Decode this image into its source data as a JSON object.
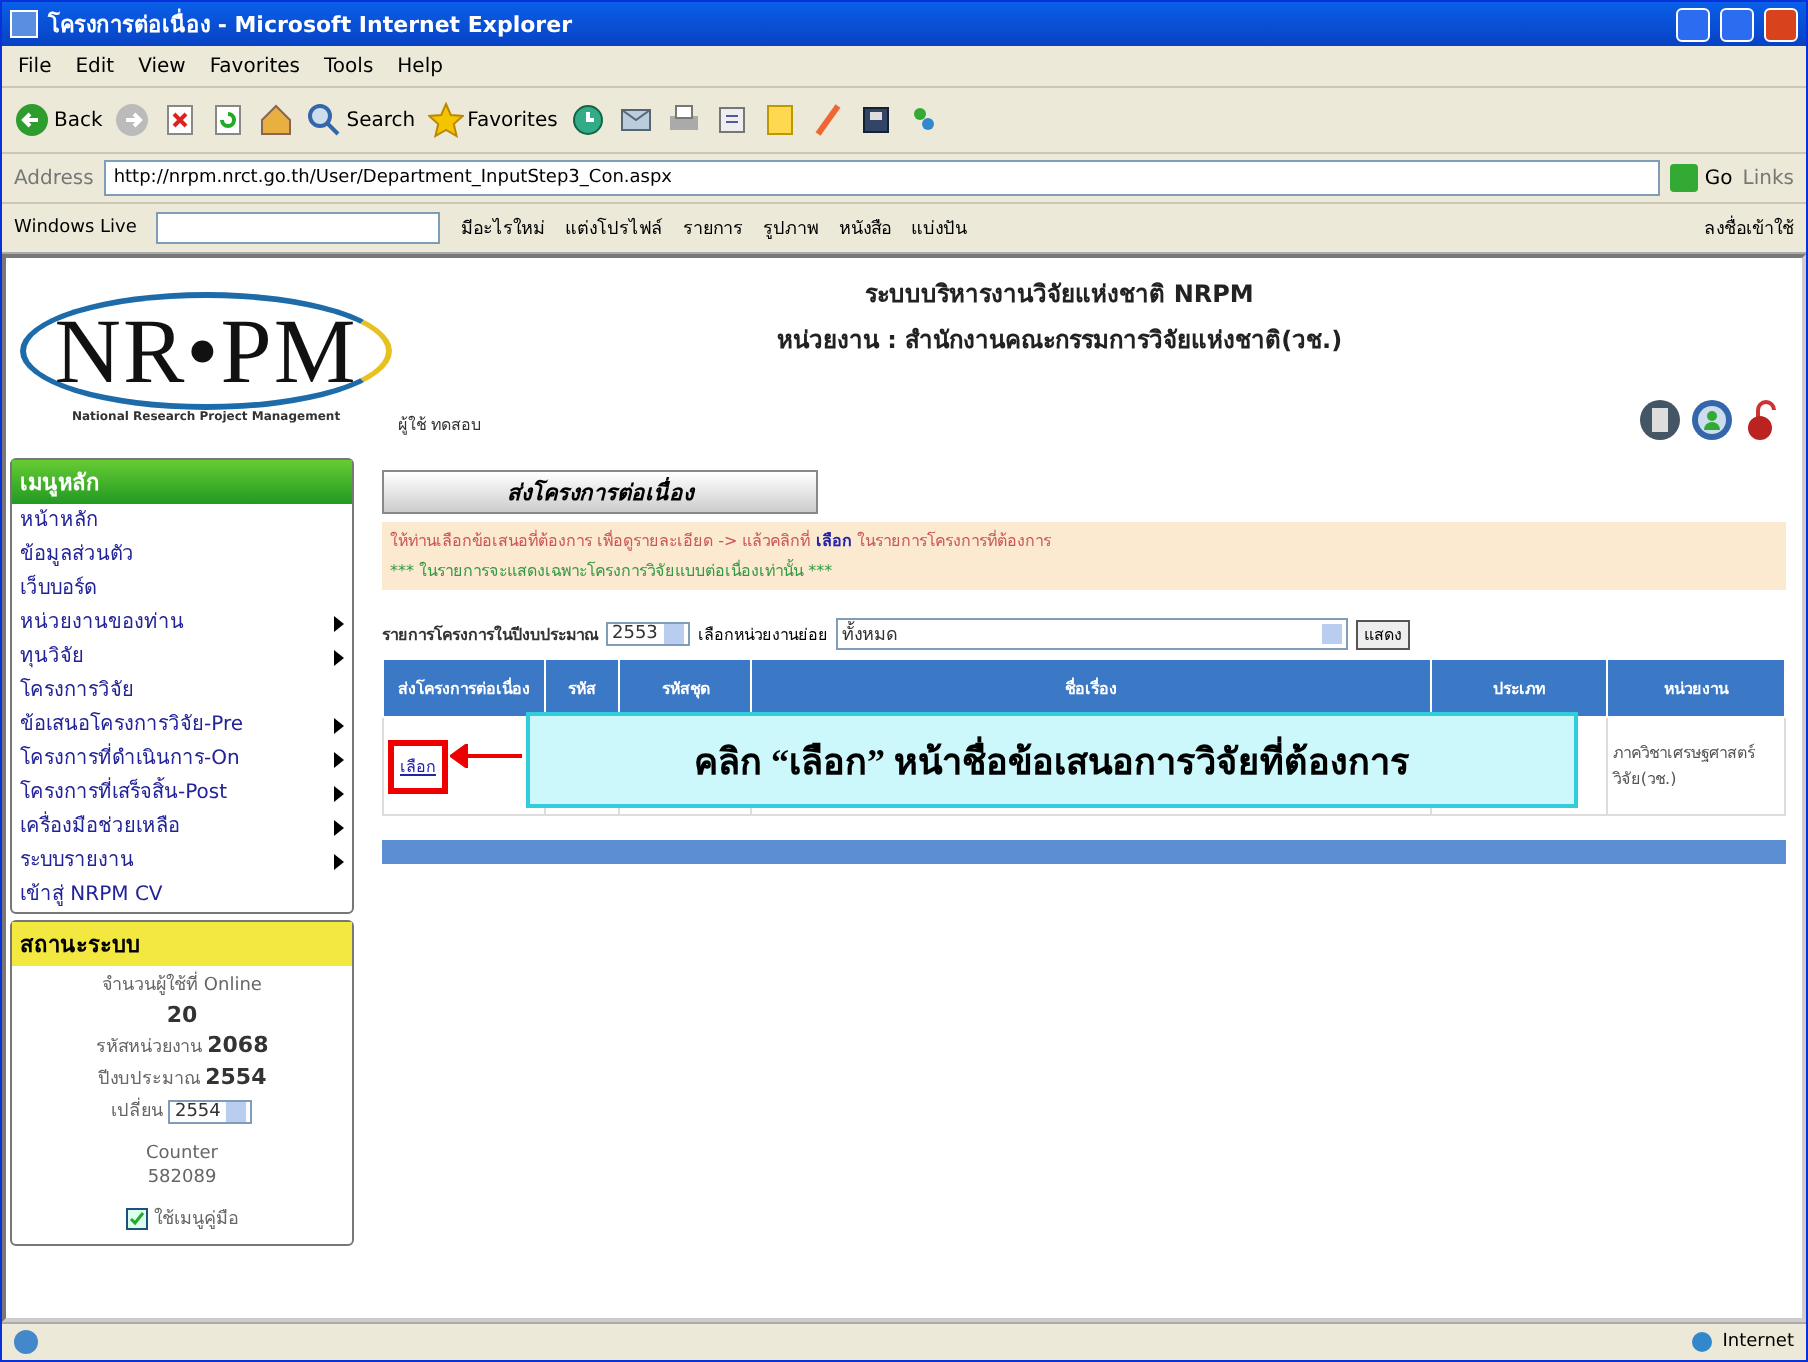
{
  "window": {
    "title": "โครงการต่อเนื่อง - Microsoft Internet Explorer"
  },
  "menu_bar": [
    "File",
    "Edit",
    "View",
    "Favorites",
    "Tools",
    "Help"
  ],
  "toolbar": [
    {
      "kind": "back",
      "label": "Back"
    },
    {
      "kind": "forward"
    },
    {
      "kind": "stop"
    },
    {
      "kind": "refresh"
    },
    {
      "kind": "home"
    },
    {
      "kind": "search",
      "label": "Search"
    },
    {
      "kind": "favorites",
      "label": "Favorites"
    },
    {
      "kind": "history"
    },
    {
      "kind": "mail"
    },
    {
      "kind": "print"
    },
    {
      "kind": "edit"
    },
    {
      "kind": "note"
    },
    {
      "kind": "pen"
    },
    {
      "kind": "book"
    },
    {
      "kind": "messenger"
    }
  ],
  "address_bar": {
    "label": "Address",
    "url": "http://nrpm.nrct.go.th/User/Department_InputStep3_Con.aspx",
    "go": "Go",
    "links": "Links"
  },
  "live_toolbar": {
    "label": "Windows Live",
    "links": [
      "มีอะไรใหม่",
      "แต่งโปรไฟล์",
      "รายการ",
      "รูปภาพ",
      "หนังสือ",
      "แบ่งปัน"
    ],
    "sign_in": "ลงชื่อเข้าใช้"
  },
  "header": {
    "system_title": "ระบบบริหารงานวิจัยแห่งชาติ NRPM",
    "agency": "หน่วยงาน : สำนักงานคณะกรรมการวิจัยแห่งชาติ(วช.)",
    "logo": "NR•PM",
    "logo_subtitle": "National Research Project Management",
    "user": "ผู้ใช้ ทดสอบ"
  },
  "sidebar": {
    "title": "เมนูหลัก",
    "items": [
      {
        "label": "หน้าหลัก",
        "submenu": false
      },
      {
        "label": "ข้อมูลส่วนตัว",
        "submenu": false
      },
      {
        "label": "เว็บบอร์ด",
        "submenu": false
      },
      {
        "label": "หน่วยงานของท่าน",
        "submenu": true
      },
      {
        "label": "ทุนวิจัย",
        "submenu": true
      },
      {
        "label": "โครงการวิจัย",
        "submenu": false
      },
      {
        "label": "ข้อเสนอโครงการวิจัย-Pre",
        "submenu": true
      },
      {
        "label": "โครงการที่ดำเนินการ-On",
        "submenu": true
      },
      {
        "label": "โครงการที่เสร็จสิ้น-Post",
        "submenu": true
      },
      {
        "label": "เครื่องมือช่วยเหลือ",
        "submenu": true
      },
      {
        "label": "ระบบรายงาน",
        "submenu": true
      },
      {
        "label": "เข้าสู่ NRPM CV",
        "submenu": false
      }
    ]
  },
  "system_status": {
    "title": "สถานะระบบ",
    "online_label": "จำนวนผู้ใช้ที่ Online",
    "online": "20",
    "agency_code_label": "รหัสหน่วยงาน",
    "agency_code": "2068",
    "fiscal_year_label": "ปีงบประมาณ",
    "fiscal_year": "2554",
    "change_label": "เปลี่ยน",
    "change_year": "2554",
    "counter_label": "Counter",
    "counter": "582089",
    "manual": {
      "label": "ใช้เมนูคู่มือ",
      "checked": true
    }
  },
  "page_button": "ส่งโครงการต่อเนื่อง",
  "notice": {
    "line1_before": "ให้ท่านเลือกข้อเสนอที่ต้องการ เพื่อดูรายละเอียด -> แล้วคลิกที่ ",
    "line1_link": "เลือก",
    "line1_after": " ในรายการโครงการที่ต้องการ",
    "line2": "*** ในรายการจะแสดงเฉพาะโครงการวิจัยแบบต่อเนื่องเท่านั้น ***"
  },
  "filter": {
    "year_label": "รายการโครงการในปีงบประมาณ",
    "year": "2553",
    "unit_label": "เลือกหน่วยงานย่อย",
    "unit": "ทั้งหมด",
    "show": "แสดง"
  },
  "table": {
    "columns": [
      "ส่งโครงการต่อเนื่อง",
      "รหัส",
      "รหัสชุด",
      "ชื่อเรื่อง",
      "ประเภท",
      "หน่วยงาน"
    ],
    "rows": [
      {
        "action": "เลือก",
        "cells": [
          "",
          "",
          "",
          "",
          ""
        ],
        "agency": "ภาควิชาเศรษฐศาสตร์ วิจัย(วช.)"
      }
    ]
  },
  "callout": "คลิก “เลือก” หน้าชื่อข้อเสนอการวิจัยที่ต้องการ",
  "status_bar": {
    "zone": "Internet"
  }
}
